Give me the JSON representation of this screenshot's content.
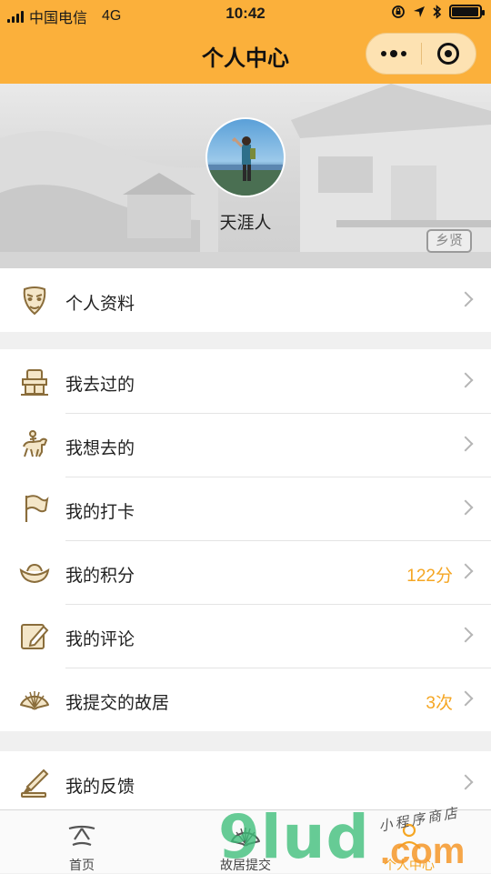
{
  "status_bar": {
    "carrier": "中国电信",
    "network": "4G",
    "time": "10:42",
    "battery_level": 0.95
  },
  "nav": {
    "title": "个人中心"
  },
  "profile": {
    "username": "天涯人",
    "badge": "乡贤"
  },
  "groups": [
    {
      "items": [
        {
          "label": "个人资料",
          "icon": "opera-mask-icon",
          "value": ""
        }
      ]
    },
    {
      "items": [
        {
          "label": "我去过的",
          "icon": "gate-icon",
          "value": ""
        },
        {
          "label": "我想去的",
          "icon": "horse-rider-icon",
          "value": ""
        },
        {
          "label": "我的打卡",
          "icon": "flag-icon",
          "value": ""
        },
        {
          "label": "我的积分",
          "icon": "gold-ingot-icon",
          "value": "122分"
        },
        {
          "label": "我的评论",
          "icon": "edit-note-icon",
          "value": ""
        },
        {
          "label": "我提交的故居",
          "icon": "fan-icon",
          "value": "3次"
        }
      ]
    },
    {
      "items": [
        {
          "label": "我的反馈",
          "icon": "brush-icon",
          "value": ""
        }
      ]
    }
  ],
  "tabs": [
    {
      "label": "首页",
      "icon": "home-icon"
    },
    {
      "label": "故居提交",
      "icon": "fan-icon"
    },
    {
      "label": "个人中心",
      "icon": "profile-icon",
      "active": true
    }
  ],
  "watermark": {
    "main": "9lud",
    "suffix": ".com",
    "tagline": "小程序商店"
  },
  "colors": {
    "brand": "#fbb03b",
    "accent_value": "#f5a623",
    "icon_stroke": "#8a6d3b"
  }
}
